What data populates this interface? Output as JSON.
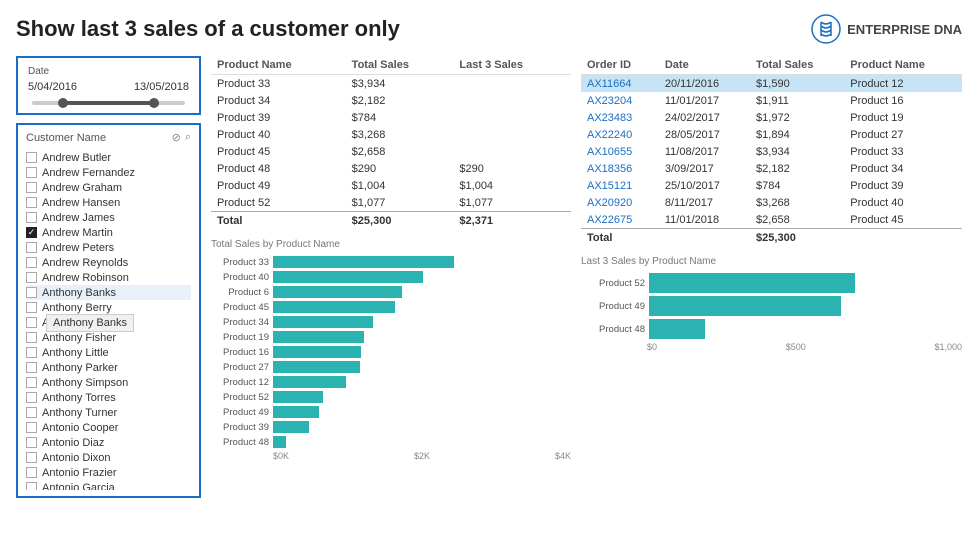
{
  "header": {
    "title": "Show last 3 sales of a customer only",
    "brand": "ENTERPRISE DNA"
  },
  "date_filter": {
    "label": "Date",
    "start": "5/04/2016",
    "end": "13/05/2018"
  },
  "customer_filter": {
    "title": "Customer Name",
    "customers": [
      {
        "name": "Andrew Butler",
        "checked": false,
        "highlighted": false
      },
      {
        "name": "Andrew Fernandez",
        "checked": false,
        "highlighted": false
      },
      {
        "name": "Andrew Graham",
        "checked": false,
        "highlighted": false
      },
      {
        "name": "Andrew Hansen",
        "checked": false,
        "highlighted": false
      },
      {
        "name": "Andrew James",
        "checked": false,
        "highlighted": false
      },
      {
        "name": "Andrew Martin",
        "checked": true,
        "highlighted": false
      },
      {
        "name": "Andrew Peters",
        "checked": false,
        "highlighted": false
      },
      {
        "name": "Andrew Reynolds",
        "checked": false,
        "highlighted": false
      },
      {
        "name": "Andrew Robinson",
        "checked": false,
        "highlighted": false
      },
      {
        "name": "Anthony Banks",
        "checked": false,
        "highlighted": true,
        "tooltip": false
      },
      {
        "name": "Anthony Berry",
        "checked": false,
        "highlighted": false
      },
      {
        "name": "Anthony Banks",
        "checked": false,
        "highlighted": false,
        "tooltip": true
      },
      {
        "name": "Anthony Fisher",
        "checked": false,
        "highlighted": false
      },
      {
        "name": "Anthony Little",
        "checked": false,
        "highlighted": false
      },
      {
        "name": "Anthony Parker",
        "checked": false,
        "highlighted": false
      },
      {
        "name": "Anthony Simpson",
        "checked": false,
        "highlighted": false
      },
      {
        "name": "Anthony Torres",
        "checked": false,
        "highlighted": false
      },
      {
        "name": "Anthony Turner",
        "checked": false,
        "highlighted": false
      },
      {
        "name": "Antonio Cooper",
        "checked": false,
        "highlighted": false
      },
      {
        "name": "Antonio Diaz",
        "checked": false,
        "highlighted": false
      },
      {
        "name": "Antonio Dixon",
        "checked": false,
        "highlighted": false
      },
      {
        "name": "Antonio Frazier",
        "checked": false,
        "highlighted": false
      },
      {
        "name": "Antonio Garcia",
        "checked": false,
        "highlighted": false
      }
    ]
  },
  "product_table": {
    "headers": [
      "Product Name",
      "Total Sales",
      "Last 3 Sales"
    ],
    "rows": [
      {
        "product": "Product 33",
        "total": "$3,934",
        "last3": ""
      },
      {
        "product": "Product 34",
        "total": "$2,182",
        "last3": ""
      },
      {
        "product": "Product 39",
        "total": "$784",
        "last3": ""
      },
      {
        "product": "Product 40",
        "total": "$3,268",
        "last3": ""
      },
      {
        "product": "Product 45",
        "total": "$2,658",
        "last3": ""
      },
      {
        "product": "Product 48",
        "total": "$290",
        "last3": "$290"
      },
      {
        "product": "Product 49",
        "total": "$1,004",
        "last3": "$1,004"
      },
      {
        "product": "Product 52",
        "total": "$1,077",
        "last3": "$1,077"
      }
    ],
    "total_row": {
      "label": "Total",
      "total": "$25,300",
      "last3": "$2,371"
    }
  },
  "total_sales_chart": {
    "title": "Total Sales by Product Name",
    "bars": [
      {
        "label": "Product 33",
        "value": 3934,
        "max": 5000
      },
      {
        "label": "Product 40",
        "value": 3268,
        "max": 5000
      },
      {
        "label": "Product 6",
        "value": 2800,
        "max": 5000
      },
      {
        "label": "Product 45",
        "value": 2658,
        "max": 5000
      },
      {
        "label": "Product 34",
        "value": 2182,
        "max": 5000
      },
      {
        "label": "Product 19",
        "value": 1972,
        "max": 5000
      },
      {
        "label": "Product 16",
        "value": 1911,
        "max": 5000
      },
      {
        "label": "Product 27",
        "value": 1894,
        "max": 5000
      },
      {
        "label": "Product 12",
        "value": 1590,
        "max": 5000
      },
      {
        "label": "Product 52",
        "value": 1077,
        "max": 5000
      },
      {
        "label": "Product 49",
        "value": 1004,
        "max": 5000
      },
      {
        "label": "Product 39",
        "value": 784,
        "max": 5000
      },
      {
        "label": "Product 48",
        "value": 290,
        "max": 5000
      }
    ],
    "x_labels": [
      "$0K",
      "$2K",
      "$4K"
    ]
  },
  "order_table": {
    "headers": [
      "Order ID",
      "Date",
      "Total Sales",
      "Product Name"
    ],
    "rows": [
      {
        "order_id": "AX11664",
        "date": "20/11/2016",
        "total": "$1,590",
        "product": "Product 12",
        "highlighted": true
      },
      {
        "order_id": "AX23204",
        "date": "11/01/2017",
        "total": "$1,911",
        "product": "Product 16",
        "highlighted": false
      },
      {
        "order_id": "AX23483",
        "date": "24/02/2017",
        "total": "$1,972",
        "product": "Product 19",
        "highlighted": false
      },
      {
        "order_id": "AX22240",
        "date": "28/05/2017",
        "total": "$1,894",
        "product": "Product 27",
        "highlighted": false
      },
      {
        "order_id": "AX10655",
        "date": "11/08/2017",
        "total": "$3,934",
        "product": "Product 33",
        "highlighted": false
      },
      {
        "order_id": "AX18356",
        "date": "3/09/2017",
        "total": "$2,182",
        "product": "Product 34",
        "highlighted": false
      },
      {
        "order_id": "AX15121",
        "date": "25/10/2017",
        "total": "$784",
        "product": "Product 39",
        "highlighted": false
      },
      {
        "order_id": "AX20920",
        "date": "8/11/2017",
        "total": "$3,268",
        "product": "Product 40",
        "highlighted": false
      },
      {
        "order_id": "AX22675",
        "date": "11/01/2018",
        "total": "$2,658",
        "product": "Product 45",
        "highlighted": false
      }
    ],
    "total_row": {
      "label": "Total",
      "total": "$25,300"
    }
  },
  "last3_chart": {
    "title": "Last 3 Sales by Product Name",
    "bars": [
      {
        "label": "Product 52",
        "value": 1077,
        "max": 1200
      },
      {
        "label": "Product 49",
        "value": 1004,
        "max": 1200
      },
      {
        "label": "Product 48",
        "value": 290,
        "max": 1200
      }
    ],
    "x_labels": [
      "$0",
      "$500",
      "$1,000"
    ]
  },
  "colors": {
    "bar_fill": "#2ab3b1",
    "accent_blue": "#1a6fc4",
    "highlight_row": "#c6e4f5"
  }
}
